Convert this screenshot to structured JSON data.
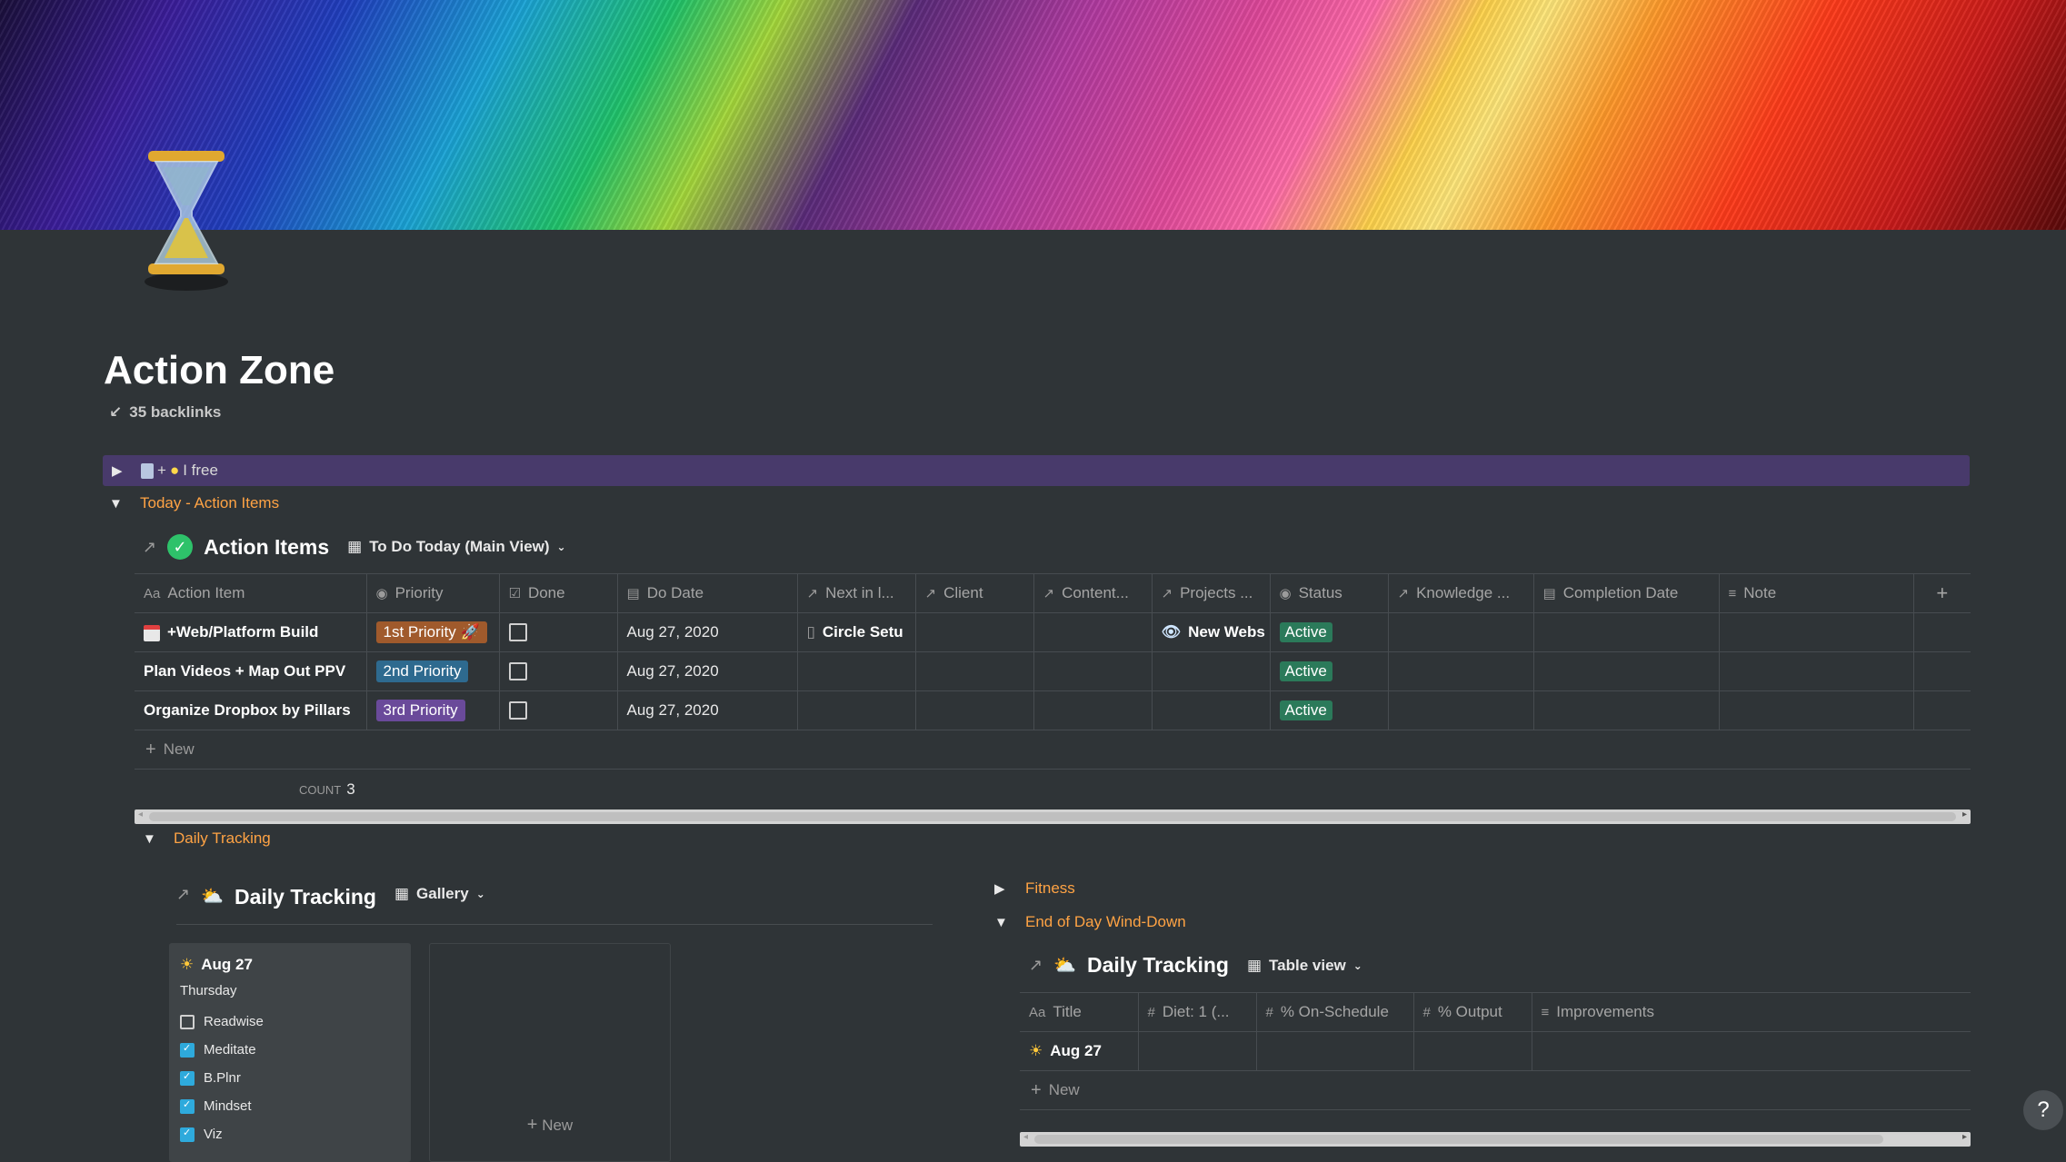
{
  "page": {
    "title": "Action Zone",
    "backlinks": "35 backlinks",
    "callout": "I free",
    "callout_plus": "+"
  },
  "sections": {
    "today": "Today - Action Items",
    "daily": "Daily Tracking",
    "fitness": "Fitness",
    "eod": "End of Day Wind-Down"
  },
  "action_db": {
    "title": "Action Items",
    "view": "To Do Today (Main View)",
    "columns": [
      "Action Item",
      "Priority",
      "Done",
      "Do Date",
      "Next in l...",
      "Client",
      "Content...",
      "Projects ...",
      "Status",
      "Knowledge ...",
      "Completion Date",
      "Note"
    ],
    "rows": [
      {
        "name": "+Web/Platform Build",
        "priority": "1st Priority",
        "done": false,
        "date": "Aug 27, 2020",
        "next": "Circle Setu",
        "project": "New Webs",
        "status": "Active"
      },
      {
        "name": "Plan Videos + Map Out PPV",
        "priority": "2nd Priority",
        "done": false,
        "date": "Aug 27, 2020",
        "next": "",
        "project": "",
        "status": "Active"
      },
      {
        "name": "Organize Dropbox by Pillars",
        "priority": "3rd Priority",
        "done": false,
        "date": "Aug 27, 2020",
        "next": "",
        "project": "",
        "status": "Active"
      }
    ],
    "new_label": "New",
    "count_label": "COUNT",
    "count_value": "3"
  },
  "gallery_db": {
    "title": "Daily Tracking",
    "view": "Gallery",
    "card": {
      "title": "Aug 27",
      "day": "Thursday",
      "habits": [
        {
          "label": "Readwise",
          "checked": false
        },
        {
          "label": "Meditate",
          "checked": true
        },
        {
          "label": "B.Plnr",
          "checked": true
        },
        {
          "label": "Mindset",
          "checked": true
        },
        {
          "label": "Viz",
          "checked": true
        }
      ]
    },
    "new_label": "New"
  },
  "table_db": {
    "title": "Daily Tracking",
    "view": "Table view",
    "columns": [
      "Title",
      "Diet: 1 (...",
      "% On-Schedule",
      "% Output",
      "Improvements"
    ],
    "row_title": "Aug 27",
    "new_label": "New"
  },
  "colors": {
    "bg": "#2f3437",
    "orange": "#ffa344",
    "p1": "#a05a2c",
    "p2": "#2e6a8f",
    "p3": "#6a4a9a",
    "active": "#2b7a5a"
  },
  "help_label": "?"
}
